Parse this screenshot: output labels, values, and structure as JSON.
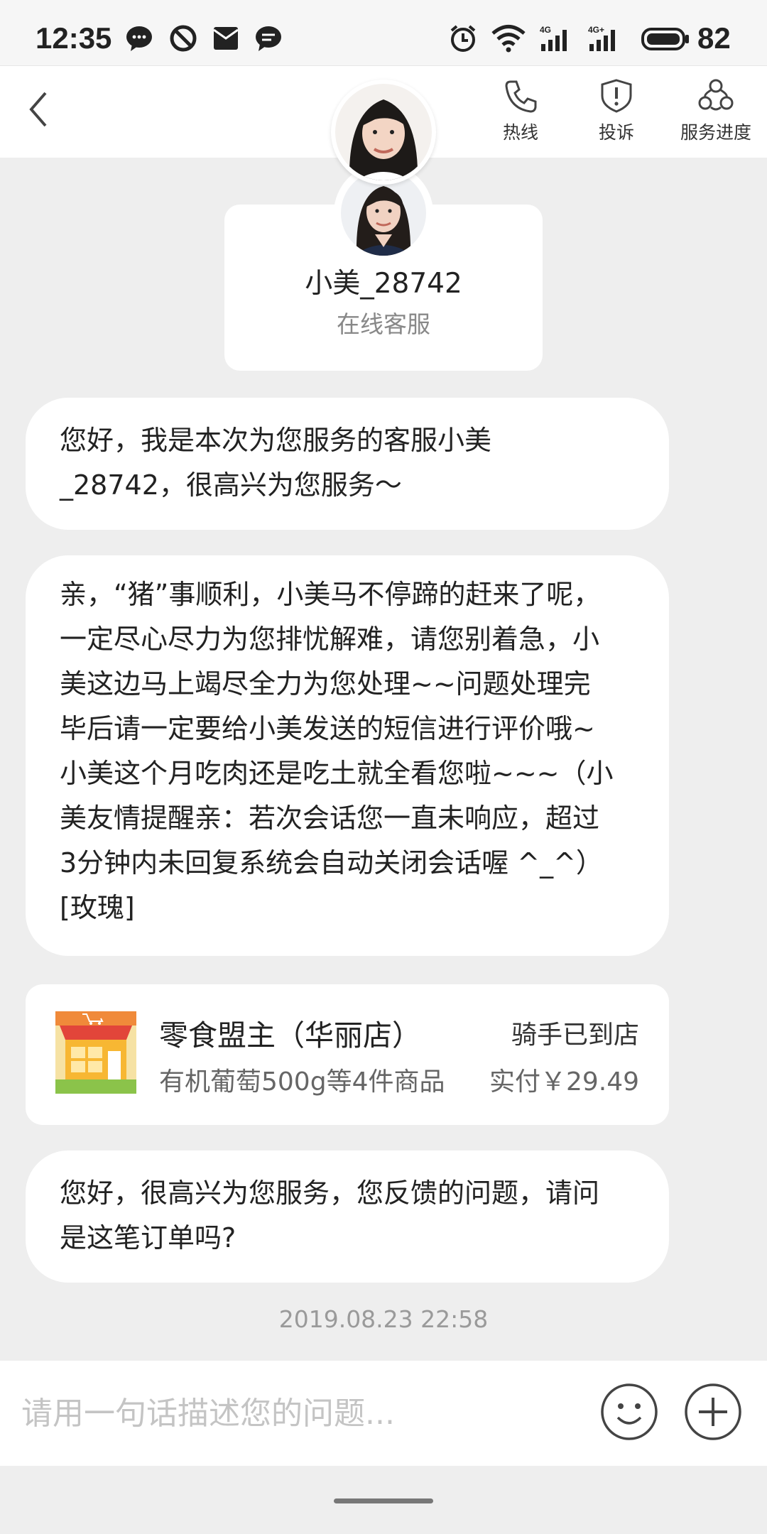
{
  "status_bar": {
    "time": "12:35",
    "battery": "82",
    "left_icons": [
      "chat-bubble-icon",
      "block-icon",
      "mail-icon",
      "message-icon"
    ],
    "right_icons": [
      "alarm-icon",
      "wifi-icon",
      "signal-4g-icon",
      "signal-4g-plus-icon",
      "battery-icon"
    ],
    "network_1": "4G",
    "network_2": "4G+"
  },
  "nav": {
    "back_icon": "chevron-left-icon",
    "actions": [
      {
        "label": "热线",
        "icon": "phone-icon"
      },
      {
        "label": "投诉",
        "icon": "shield-alert-icon"
      },
      {
        "label": "服务进度",
        "icon": "progress-icon"
      }
    ]
  },
  "agent": {
    "name": "小美_28742",
    "role": "在线客服"
  },
  "messages": {
    "m1": [
      "您好，我是本次为您服务的客服小美",
      "_28742，很高兴为您服务～"
    ],
    "m2": [
      "亲，“猪”事顺利，小美马不停蹄的赶来了呢，",
      "一定尽心尽力为您排忧解难，请您别着急，小",
      "美这边马上竭尽全力为您处理~~问题处理完",
      "毕后请一定要给小美发送的短信进行评价哦~",
      "小美这个月吃肉还是吃土就全看您啦~~~（小",
      "美友情提醒亲：若次会话您一直未响应，超过",
      "3分钟内未回复系统会自动关闭会话喔 ^_^）",
      "[玫瑰]"
    ],
    "m4": [
      "您好，很高兴为您服务，您反馈的问题，请问",
      "是这笔订单吗?"
    ]
  },
  "order": {
    "store": "零食盟主（华丽店）",
    "items": "有机葡萄500g等4件商品",
    "status": "骑手已到店",
    "paid": "实付￥29.49"
  },
  "timestamp": "2019.08.23 22:58",
  "input": {
    "placeholder": "请用一句话描述您的问题..."
  },
  "colors": {
    "background": "#eeeeee",
    "bubble": "#ffffff",
    "muted_text": "#888888"
  }
}
